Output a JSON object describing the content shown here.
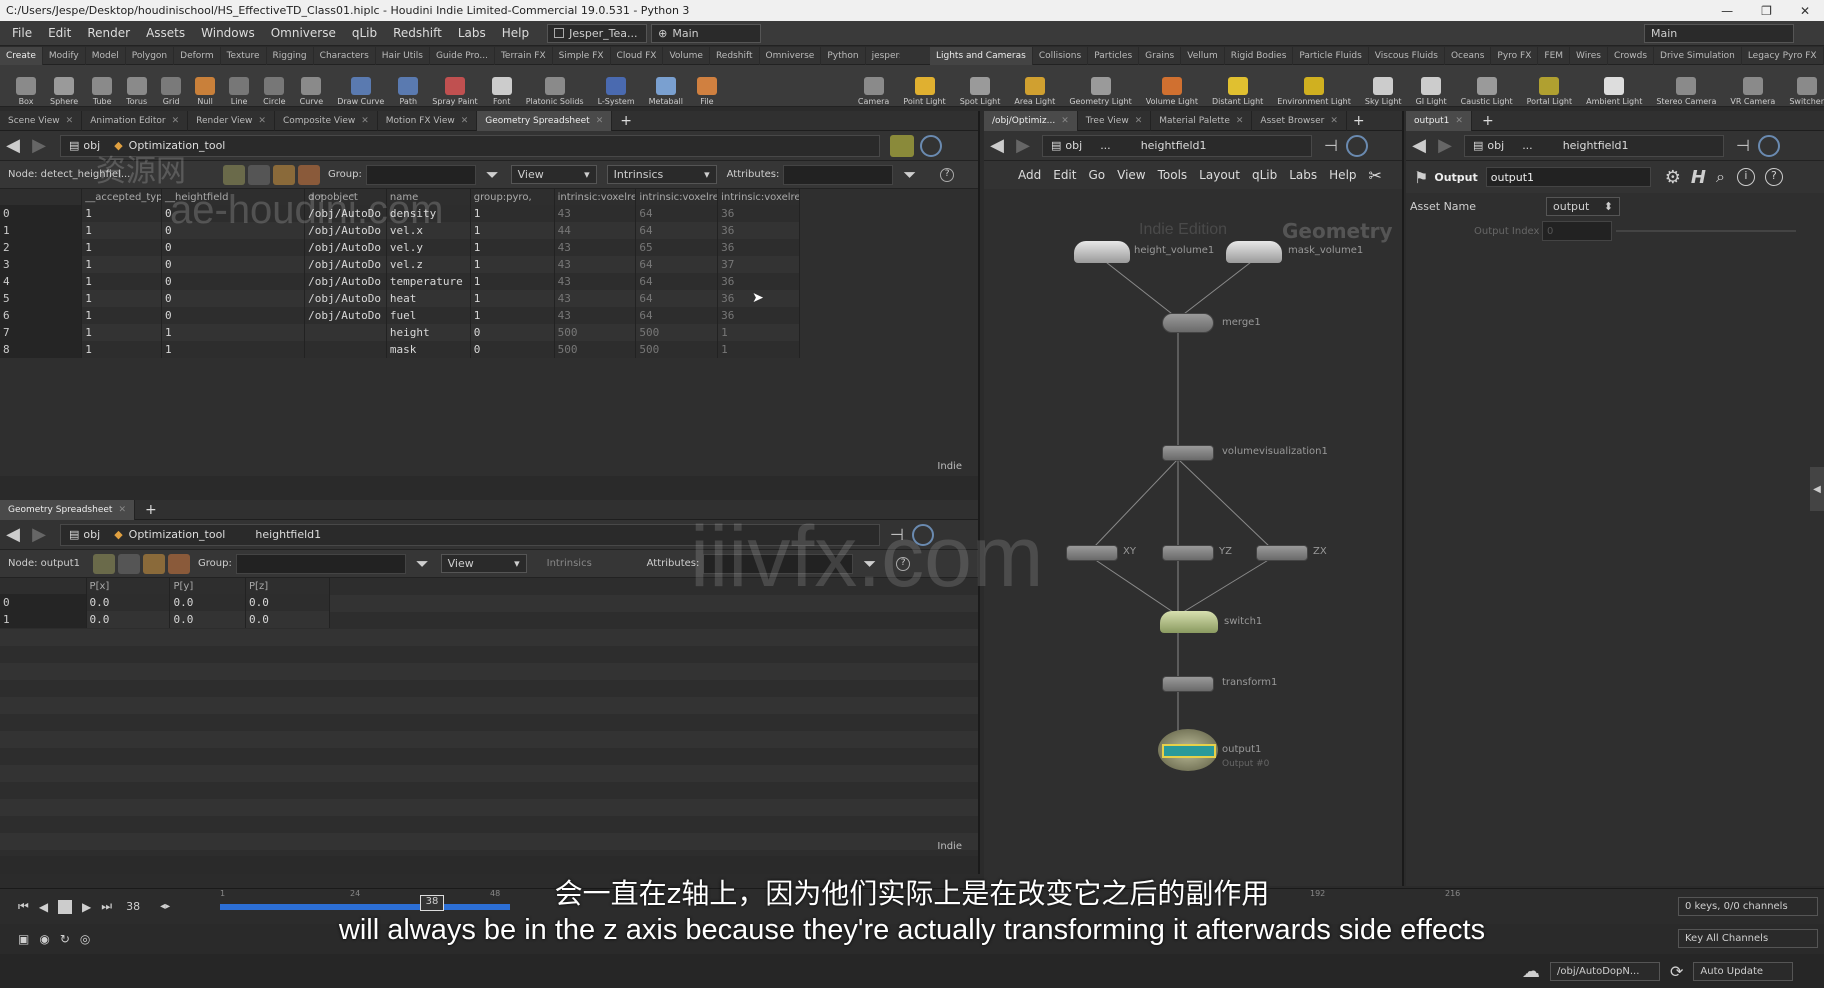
{
  "window": {
    "title": "C:/Users/Jespe/Desktop/houdinischool/HS_EffectiveTD_Class01.hiplc - Houdini Indie Limited-Commercial 19.0.531 - Python 3",
    "controls": [
      "—",
      "❐",
      "✕"
    ]
  },
  "menubar": {
    "items": [
      "File",
      "Edit",
      "Render",
      "Assets",
      "Windows",
      "Omniverse",
      "qLib",
      "Redshift",
      "Labs",
      "Help"
    ],
    "desktop": "Jesper_Tea...",
    "context": "Main",
    "right_context": "Main"
  },
  "shelf_tabs_left": [
    "Create",
    "Modify",
    "Model",
    "Polygon",
    "Deform",
    "Texture",
    "Rigging",
    "Characters",
    "Hair Utils",
    "Guide Pro...",
    "Terrain FX",
    "Simple FX",
    "Cloud FX",
    "Volume",
    "Redshift",
    "Omniverse",
    "Python",
    "jespers shelf"
  ],
  "shelf_tabs_right": [
    "Lights and Cameras",
    "Collisions",
    "Particles",
    "Grains",
    "Vellum",
    "Rigid Bodies",
    "Particle Fluids",
    "Viscous Fluids",
    "Oceans",
    "Pyro FX",
    "FEM",
    "Wires",
    "Crowds",
    "Drive Simulation",
    "Legacy Pyro FX"
  ],
  "shelf_tools_left": [
    {
      "label": "Box",
      "color": "#8a8a8a"
    },
    {
      "label": "Sphere",
      "color": "#9a9a9a"
    },
    {
      "label": "Tube",
      "color": "#8a8a8a"
    },
    {
      "label": "Torus",
      "color": "#8a8a8a"
    },
    {
      "label": "Grid",
      "color": "#7a7a7a"
    },
    {
      "label": "Null",
      "color": "#c9803a"
    },
    {
      "label": "Line",
      "color": "#777777"
    },
    {
      "label": "Circle",
      "color": "#777777"
    },
    {
      "label": "Curve",
      "color": "#8a8a8a"
    },
    {
      "label": "Draw Curve",
      "color": "#5a7ab0"
    },
    {
      "label": "Path",
      "color": "#5a7ab0"
    },
    {
      "label": "Spray Paint",
      "color": "#c05050"
    },
    {
      "label": "Font",
      "color": "#cccccc"
    },
    {
      "label": "Platonic Solids",
      "color": "#8a8a8a"
    },
    {
      "label": "L-System",
      "color": "#4a6ab0"
    },
    {
      "label": "Metaball",
      "color": "#7aa0d0"
    },
    {
      "label": "File",
      "color": "#d08040"
    }
  ],
  "shelf_tools_right": [
    {
      "label": "Camera",
      "color": "#8a8a8a"
    },
    {
      "label": "Point Light",
      "color": "#e0b030"
    },
    {
      "label": "Spot Light",
      "color": "#9a9a9a"
    },
    {
      "label": "Area Light",
      "color": "#d0a030"
    },
    {
      "label": "Geometry Light",
      "color": "#9a9a9a"
    },
    {
      "label": "Volume Light",
      "color": "#d07030"
    },
    {
      "label": "Distant Light",
      "color": "#e0c030"
    },
    {
      "label": "Environment Light",
      "color": "#d0b020"
    },
    {
      "label": "Sky Light",
      "color": "#cccccc"
    },
    {
      "label": "GI Light",
      "color": "#cccccc"
    },
    {
      "label": "Caustic Light",
      "color": "#9a9a9a"
    },
    {
      "label": "Portal Light",
      "color": "#b0a030"
    },
    {
      "label": "Ambient Light",
      "color": "#dddddd"
    },
    {
      "label": "Stereo Camera",
      "color": "#8a8a8a"
    },
    {
      "label": "VR Camera",
      "color": "#8a8a8a"
    },
    {
      "label": "Switcher",
      "color": "#8a8a8a"
    }
  ],
  "left_pane_tabs": [
    "Scene View",
    "Animation Editor",
    "Render View",
    "Composite View",
    "Motion FX View",
    "Geometry Spreadsheet"
  ],
  "top_sheet": {
    "path": [
      "obj",
      "Optimization_tool"
    ],
    "node_label": "Node: detect_heighfiel...",
    "group_label": "Group:",
    "view_label": "View",
    "intrinsics_label": "Intrinsics",
    "attributes_label": "Attributes:",
    "columns": [
      "",
      "__accepted_typ",
      "__heightfield",
      "dopobject",
      "name",
      "group:pyro,",
      "intrinsic:voxelre",
      "intrinsic:voxelre",
      "intrinsic:voxelre"
    ],
    "rows": [
      [
        "0",
        "1",
        "0",
        "/obj/AutoDo",
        "density",
        "1",
        "43",
        "64",
        "36"
      ],
      [
        "1",
        "1",
        "0",
        "/obj/AutoDo",
        "vel.x",
        "1",
        "44",
        "64",
        "36"
      ],
      [
        "2",
        "1",
        "0",
        "/obj/AutoDo",
        "vel.y",
        "1",
        "43",
        "65",
        "36"
      ],
      [
        "3",
        "1",
        "0",
        "/obj/AutoDo",
        "vel.z",
        "1",
        "43",
        "64",
        "37"
      ],
      [
        "4",
        "1",
        "0",
        "/obj/AutoDo",
        "temperature",
        "1",
        "43",
        "64",
        "36"
      ],
      [
        "5",
        "1",
        "0",
        "/obj/AutoDo",
        "heat",
        "1",
        "43",
        "64",
        "36"
      ],
      [
        "6",
        "1",
        "0",
        "/obj/AutoDo",
        "fuel",
        "1",
        "43",
        "64",
        "36"
      ],
      [
        "7",
        "1",
        "1",
        "",
        "height",
        "0",
        "500",
        "500",
        "1"
      ],
      [
        "8",
        "1",
        "1",
        "",
        "mask",
        "0",
        "500",
        "500",
        "1"
      ]
    ],
    "footer": "Indie"
  },
  "bottom_sheet": {
    "tab": "Geometry Spreadsheet",
    "path": [
      "obj",
      "Optimization_tool",
      "heightfield1"
    ],
    "node_label": "Node: output1",
    "group_label": "Group:",
    "view_label": "View",
    "intrinsics_label": "Intrinsics",
    "attributes_label": "Attributes:",
    "columns": [
      "",
      "P[x]",
      "P[y]",
      "P[z]"
    ],
    "rows": [
      [
        "0",
        "0.0",
        "0.0",
        "0.0"
      ],
      [
        "1",
        "0.0",
        "0.0",
        "0.0"
      ]
    ],
    "footer": "Indie"
  },
  "network": {
    "tabs": [
      "/obj/Optimiz...",
      "Tree View",
      "Material Palette",
      "Asset Browser"
    ],
    "path": [
      "obj",
      "...",
      "heightfield1"
    ],
    "menu": [
      "Add",
      "Edit",
      "Go",
      "View",
      "Tools",
      "Layout",
      "qLib",
      "Labs",
      "Help"
    ],
    "watermark_edition": "Indie Edition",
    "watermark_context": "Geometry",
    "nodes": {
      "height_volume": "height_volume1",
      "mask_volume": "mask_volume1",
      "merge": "merge1",
      "visualization": "volumevisualization1",
      "xy": "XY",
      "yz": "YZ",
      "zx": "ZX",
      "switch": "switch1",
      "transform": "transform1",
      "output": "output1",
      "output_sub": "Output #0"
    }
  },
  "params": {
    "tab": "output1",
    "path": [
      "obj",
      "...",
      "heightfield1"
    ],
    "node_type": "Output",
    "node_name": "output1",
    "asset_name_label": "Asset Name",
    "asset_name_value": "output",
    "output_index_label": "Output Index",
    "output_index_value": "0"
  },
  "timeline": {
    "current_frame": "38",
    "marker": "38",
    "ticks": [
      "1",
      "24",
      "48",
      "192",
      "216"
    ],
    "keys_info": "0 keys, 0/0 channels",
    "key_all": "Key All Channels",
    "path": "/obj/AutoDopN...",
    "auto_update": "Auto Update"
  },
  "subtitles": {
    "cn": "会一直在z轴上，因为他们实际上是在改变它之后的副作用",
    "en": "will always be in the z axis because they're actually transforming it afterwards side effects"
  },
  "watermarks": {
    "site1": "ae-houdini.com",
    "site1_cn": "资源网",
    "site2": "iiivfx.com"
  },
  "colors": {
    "selected_node": "#2a9a9a",
    "timeline_bar": "#2c6fd6",
    "switch_node": "#b9c98a"
  }
}
